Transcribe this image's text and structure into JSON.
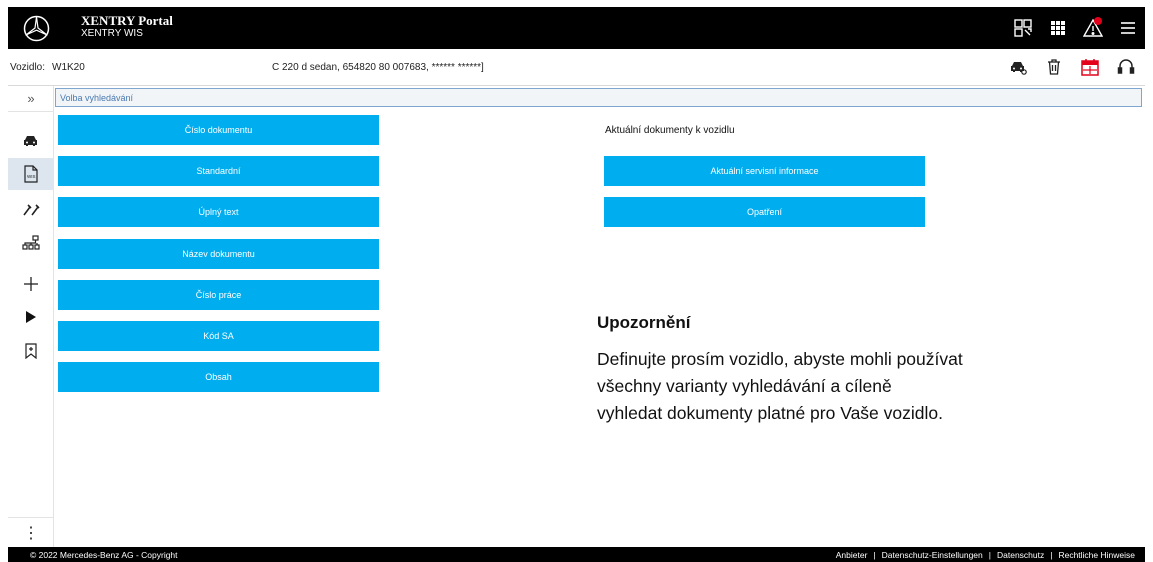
{
  "header": {
    "title": "XENTRY Portal",
    "subtitle": "XENTRY WIS",
    "icons": [
      "qr-scan-icon",
      "apps-grid-icon",
      "warning-icon",
      "menu-icon"
    ]
  },
  "vehicle": {
    "label": "Vozidlo:",
    "vin": "W1K20",
    "description": "C 220 d sedan, 654820 80 007683, ****** ******]",
    "icons": [
      "car-search-icon",
      "trash-icon",
      "calendar-icon",
      "headset-icon"
    ]
  },
  "breadcrumb": "Volba vyhledávání",
  "search_buttons": [
    "Číslo dokumentu",
    "Standardní",
    "Úplný text",
    "Název dokumentu",
    "Číslo práce",
    "Kód SA",
    "Obsah"
  ],
  "current_docs": {
    "label": "Aktuální dokumenty k vozidlu",
    "buttons": [
      "Aktuální servisní informace",
      "Opatření"
    ]
  },
  "notice": {
    "title": "Upozornění",
    "lines": [
      "Definujte prosím vozidlo, abyste mohli používat",
      "všechny varianty vyhledávání a cíleně",
      "vyhledat dokumenty platné pro Vaše vozidlo."
    ]
  },
  "sidebar": {
    "toggle": "»",
    "items": [
      "car-search-icon",
      "wis-document-icon",
      "tools-icon",
      "network-icon",
      "plus-icon",
      "play-icon",
      "bookmark-icon"
    ],
    "more": "⋮"
  },
  "footer": {
    "copyright": "© 2022 Mercedes-Benz AG - Copyright",
    "links": [
      "Anbieter",
      "Datenschutz-Einstellungen",
      "Datenschutz",
      "Rechtliche Hinweise"
    ]
  },
  "colors": {
    "accent": "#00adef",
    "header_bg": "#000000",
    "active_rail": "#dde6ef",
    "warning_dot": "#e2001a"
  }
}
